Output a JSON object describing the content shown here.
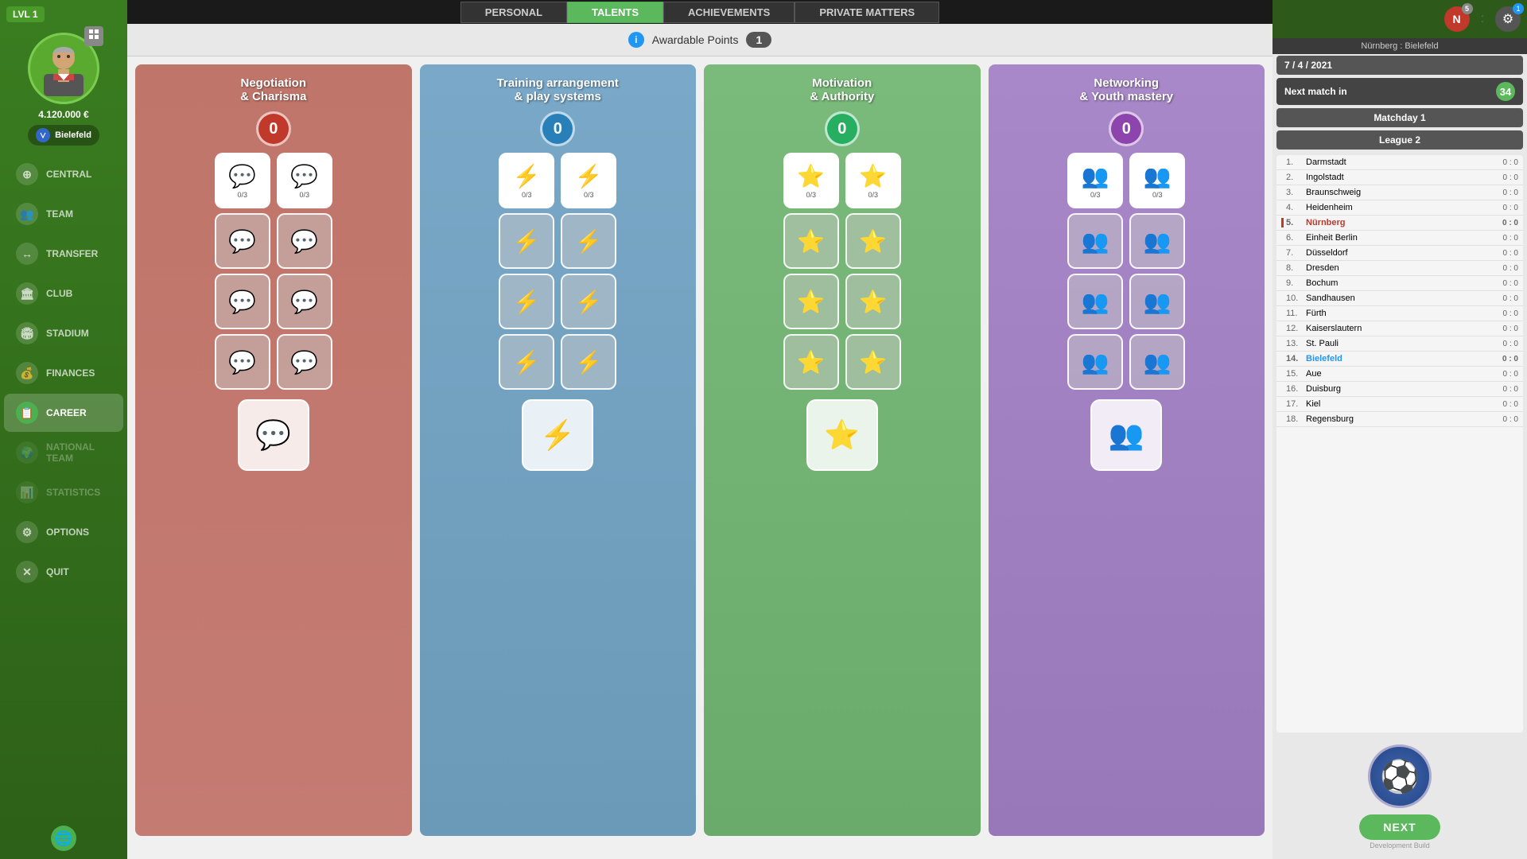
{
  "player": {
    "level": "LVL 1",
    "money": "4.120.000 €",
    "team": "Bielefeld"
  },
  "topnav": {
    "tabs": [
      {
        "id": "personal",
        "label": "PERSONAL",
        "active": false
      },
      {
        "id": "talents",
        "label": "TALENTS",
        "active": true
      },
      {
        "id": "achievements",
        "label": "ACHIEVEMENTS",
        "active": false
      },
      {
        "id": "private",
        "label": "PRIVATE MATTERS",
        "active": false
      }
    ]
  },
  "sidebar": {
    "items": [
      {
        "id": "central",
        "label": "CENTRAL",
        "icon": "⊕",
        "active": false
      },
      {
        "id": "team",
        "label": "TEAM",
        "icon": "👥",
        "active": false
      },
      {
        "id": "transfer",
        "label": "TRANSFER",
        "icon": "↔",
        "active": false
      },
      {
        "id": "club",
        "label": "CLUB",
        "icon": "🏛",
        "active": false
      },
      {
        "id": "stadium",
        "label": "STADIUM",
        "icon": "🏟",
        "active": false
      },
      {
        "id": "finances",
        "label": "FINANCES",
        "icon": "💰",
        "active": false
      },
      {
        "id": "career",
        "label": "CAREER",
        "icon": "📋",
        "active": true
      },
      {
        "id": "national",
        "label": "NATIONAL TEAM",
        "icon": "🌍",
        "disabled": true
      },
      {
        "id": "statistics",
        "label": "STATISTICS",
        "icon": "📊",
        "disabled": true
      },
      {
        "id": "options",
        "label": "OPTIONS",
        "icon": "⚙",
        "active": false
      },
      {
        "id": "quit",
        "label": "QUIT",
        "icon": "✕",
        "active": false
      }
    ]
  },
  "points": {
    "label": "Awardable Points",
    "value": "1"
  },
  "rightpanel": {
    "match_vs": "Nürnberg : Bielefeld",
    "date": "7 / 4 / 2021",
    "next_match_label": "Next match in",
    "next_match_value": "34",
    "matchday": "Matchday 1",
    "league": "League 2",
    "next_btn": "NEXT",
    "dev_build": "Development Build"
  },
  "league_table": [
    {
      "pos": "1.",
      "team": "Darmstadt",
      "score": "0 : 0",
      "highlight": ""
    },
    {
      "pos": "2.",
      "team": "Ingolstadt",
      "score": "0 : 0",
      "highlight": ""
    },
    {
      "pos": "3.",
      "team": "Braunschweig",
      "score": "0 : 0",
      "highlight": ""
    },
    {
      "pos": "4.",
      "team": "Heidenheim",
      "score": "0 : 0",
      "highlight": ""
    },
    {
      "pos": "5.",
      "team": "Nürnberg",
      "score": "0 : 0",
      "highlight": "red"
    },
    {
      "pos": "6.",
      "team": "Einheit Berlin",
      "score": "0 : 0",
      "highlight": ""
    },
    {
      "pos": "7.",
      "team": "Düsseldorf",
      "score": "0 : 0",
      "highlight": ""
    },
    {
      "pos": "8.",
      "team": "Dresden",
      "score": "0 : 0",
      "highlight": ""
    },
    {
      "pos": "9.",
      "team": "Bochum",
      "score": "0 : 0",
      "highlight": ""
    },
    {
      "pos": "10.",
      "team": "Sandhausen",
      "score": "0 : 0",
      "highlight": ""
    },
    {
      "pos": "11.",
      "team": "Fürth",
      "score": "0 : 0",
      "highlight": ""
    },
    {
      "pos": "12.",
      "team": "Kaiserslautern",
      "score": "0 : 0",
      "highlight": ""
    },
    {
      "pos": "13.",
      "team": "St. Pauli",
      "score": "0 : 0",
      "highlight": ""
    },
    {
      "pos": "14.",
      "team": "Bielefeld",
      "score": "0 : 0",
      "highlight": "blue"
    },
    {
      "pos": "15.",
      "team": "Aue",
      "score": "0 : 0",
      "highlight": ""
    },
    {
      "pos": "16.",
      "team": "Duisburg",
      "score": "0 : 0",
      "highlight": ""
    },
    {
      "pos": "17.",
      "team": "Kiel",
      "score": "0 : 0",
      "highlight": ""
    },
    {
      "pos": "18.",
      "team": "Regensburg",
      "score": "0 : 0",
      "highlight": ""
    }
  ],
  "talents": {
    "negotiation": {
      "title": "Negotiation",
      "subtitle": "& Charisma",
      "badge_color": "red",
      "badge_value": "0",
      "icon_active": "💬",
      "icon_inactive": "💬"
    },
    "training": {
      "title": "Training arrangement",
      "subtitle": "& play systems",
      "badge_color": "blue",
      "badge_value": "0",
      "icon_active": "⚡",
      "icon_inactive": "⚡"
    },
    "motivation": {
      "title": "Motivation",
      "subtitle": "& Authority",
      "badge_color": "green",
      "badge_value": "0",
      "icon_active": "⭐",
      "icon_inactive": "⭐"
    },
    "networking": {
      "title": "Networking",
      "subtitle": "& Youth mastery",
      "badge_color": "purple",
      "badge_value": "0",
      "icon_active": "👥",
      "icon_inactive": "👥"
    }
  }
}
